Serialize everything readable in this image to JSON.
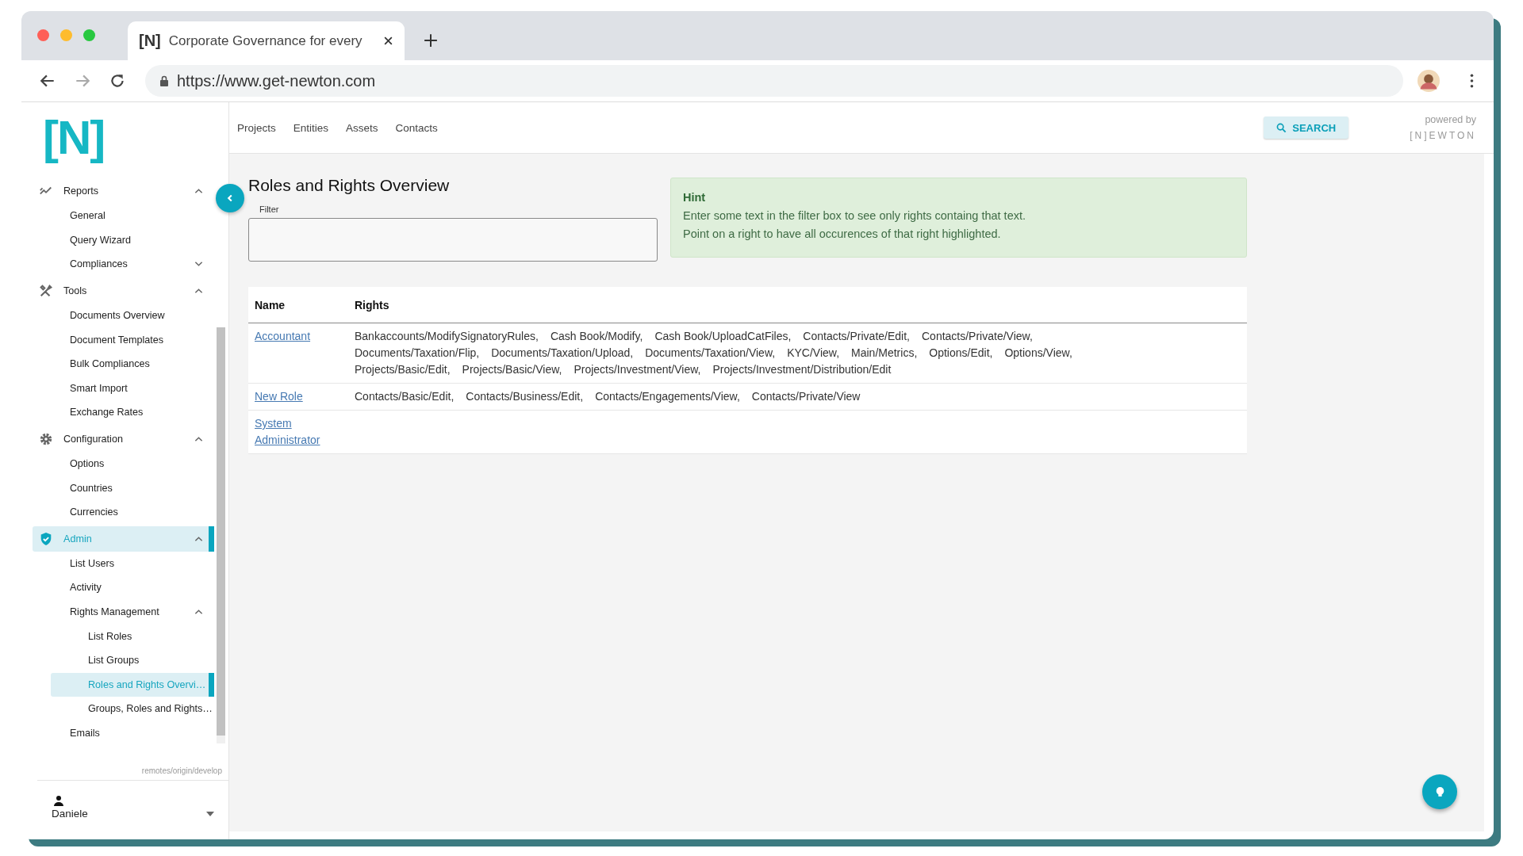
{
  "browser": {
    "tab_icon": "[N]",
    "tab_title": "Corporate Governance for every",
    "url": "https://www.get-newton.com"
  },
  "logo": "[N]",
  "nav": [
    "Projects",
    "Entities",
    "Assets",
    "Contacts"
  ],
  "search_button": "SEARCH",
  "powered_by": {
    "label": "powered by",
    "logo": "[N]EWTON"
  },
  "sidebar": {
    "items": [
      {
        "label": "Reports",
        "selected": false,
        "expanded": true,
        "children": [
          {
            "label": "General",
            "selected": false
          },
          {
            "label": "Query Wizard",
            "selected": false
          },
          {
            "label": "Compliances",
            "selected": false,
            "expanded": false
          }
        ]
      },
      {
        "label": "Tools",
        "selected": false,
        "expanded": true,
        "children": [
          {
            "label": "Documents Overview",
            "selected": false
          },
          {
            "label": "Document Templates",
            "selected": false
          },
          {
            "label": "Bulk Compliances",
            "selected": false
          },
          {
            "label": "Smart Import",
            "selected": false
          },
          {
            "label": "Exchange Rates",
            "selected": false
          }
        ]
      },
      {
        "label": "Configuration",
        "selected": false,
        "expanded": true,
        "children": [
          {
            "label": "Options",
            "selected": false
          },
          {
            "label": "Countries",
            "selected": false
          },
          {
            "label": "Currencies",
            "selected": false
          }
        ]
      },
      {
        "label": "Admin",
        "selected": true,
        "expanded": true,
        "children": [
          {
            "label": "List Users",
            "selected": false
          },
          {
            "label": "Activity",
            "selected": false
          },
          {
            "label": "Rights Management",
            "selected": false,
            "expanded": true,
            "children": [
              {
                "label": "List Roles",
                "selected": false
              },
              {
                "label": "List Groups",
                "selected": false
              },
              {
                "label": "Roles and Rights Overvi…",
                "selected": true
              },
              {
                "label": "Groups, Roles and Rights…",
                "selected": false
              }
            ]
          },
          {
            "label": "Emails",
            "selected": false
          }
        ]
      }
    ],
    "branch": "remotes/origin/develop",
    "user": "Daniele"
  },
  "page": {
    "title": "Roles and Rights Overview",
    "filter": {
      "label": "Filter"
    },
    "hint": {
      "title": "Hint",
      "lines": [
        "Enter some text in the filter box to see only rights containg that text.",
        "Point on a right to have all occurences of that right highlighted."
      ]
    },
    "table": {
      "columns": [
        "Name",
        "Rights"
      ],
      "rows": [
        {
          "name": "Accountant",
          "rights": [
            "Bankaccounts/ModifySignatoryRules,",
            "Cash Book/Modify,",
            "Cash Book/UploadCatFiles,",
            "Contacts/Private/Edit,",
            "Contacts/Private/View,",
            "Documents/Taxation/Flip,",
            "Documents/Taxation/Upload,",
            "Documents/Taxation/View,",
            "KYC/View,",
            "Main/Metrics,",
            "Options/Edit,",
            "Options/View,",
            "Projects/Basic/Edit,",
            "Projects/Basic/View,",
            "Projects/Investment/View,",
            "Projects/Investment/Distribution/Edit"
          ]
        },
        {
          "name": "New Role",
          "rights": [
            "Contacts/Basic/Edit,",
            "Contacts/Business/Edit,",
            "Contacts/Engagements/View,",
            "Contacts/Private/View"
          ]
        },
        {
          "name": "System Administrator"
        }
      ]
    }
  }
}
